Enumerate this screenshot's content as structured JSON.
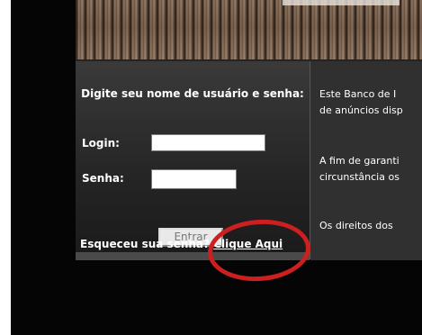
{
  "login": {
    "prompt": "Digite seu nome de usuário e senha:",
    "login_label": "Login:",
    "login_value": "",
    "password_label": "Senha:",
    "password_value": "",
    "submit_label": "Entrar",
    "forgot_text": "Esqueceu sua senha? ",
    "forgot_link": "Clique Aqui"
  },
  "info": {
    "line1": "Este Banco de I",
    "line2": "de anúncios disp",
    "line3": "A fim de garanti",
    "line4": "circunstância os",
    "line5": "Os direitos dos"
  },
  "colors": {
    "annotation": "#cc1f1f",
    "panel_background": "#303030"
  }
}
